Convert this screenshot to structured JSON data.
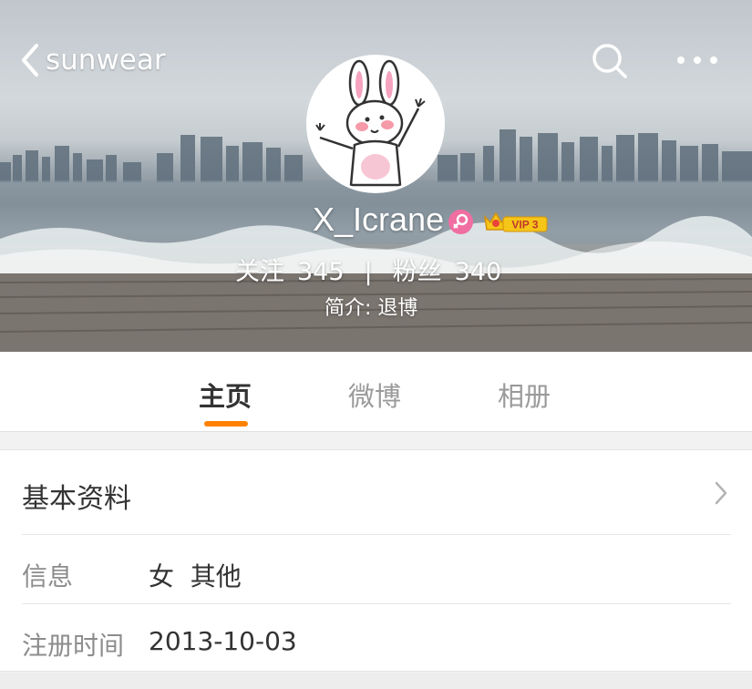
{
  "header": {
    "back_label": "sunwear",
    "icons": {
      "back": "chevron-left-icon",
      "search": "search-icon",
      "more": "more-horizontal-icon"
    }
  },
  "profile": {
    "username": "X_Icrane",
    "gender_badge_icon": "female-icon",
    "vip_badge_text": "VIP 3",
    "following_label": "关注",
    "following_count": "345",
    "separator": "|",
    "followers_label": "粉丝",
    "followers_count": "340",
    "bio": "简介: 退博"
  },
  "tabs": [
    {
      "label": "主页",
      "active": true
    },
    {
      "label": "微博",
      "active": false
    },
    {
      "label": "相册",
      "active": false
    }
  ],
  "info": {
    "title": "基本资料",
    "rows": [
      {
        "label": "信息",
        "value": "女  其他"
      },
      {
        "label": "注册时间",
        "value": "2013-10-03"
      }
    ]
  },
  "colors": {
    "accent": "#ff8200",
    "female_badge": "#f06ea1",
    "vip_gold": "#f5c518"
  }
}
